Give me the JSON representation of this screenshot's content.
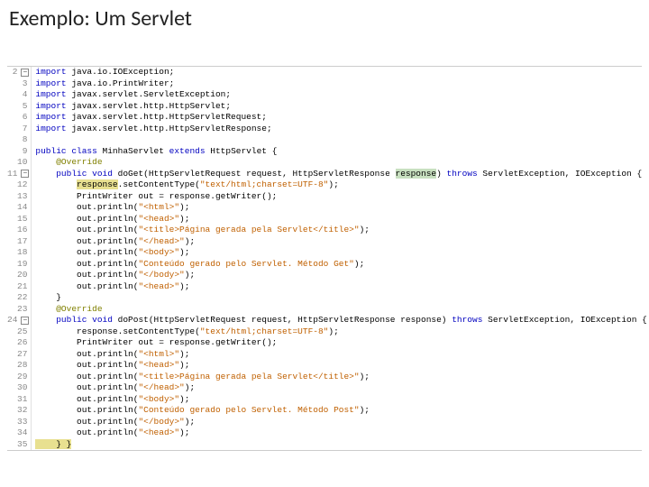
{
  "title": "Exemplo: Um Servlet",
  "code": {
    "line_numbers": [
      "2",
      "3",
      "4",
      "5",
      "6",
      "7",
      "8",
      "9",
      "10",
      "11",
      "12",
      "13",
      "14",
      "15",
      "16",
      "17",
      "18",
      "19",
      "20",
      "21",
      "22",
      "23",
      "24",
      "25",
      "26",
      "27",
      "28",
      "29",
      "30",
      "31",
      "32",
      "33",
      "34",
      "35"
    ],
    "fold_lines": [
      0,
      9,
      22
    ],
    "lines": [
      [
        {
          "t": "kw",
          "s": "import"
        },
        {
          "t": "",
          "s": " java.io.IOException;"
        }
      ],
      [
        {
          "t": "kw",
          "s": "import"
        },
        {
          "t": "",
          "s": " java.io.PrintWriter;"
        }
      ],
      [
        {
          "t": "kw",
          "s": "import"
        },
        {
          "t": "",
          "s": " javax.servlet.ServletException;"
        }
      ],
      [
        {
          "t": "kw",
          "s": "import"
        },
        {
          "t": "",
          "s": " javax.servlet.http.HttpServlet;"
        }
      ],
      [
        {
          "t": "kw",
          "s": "import"
        },
        {
          "t": "",
          "s": " javax.servlet.http.HttpServletRequest;"
        }
      ],
      [
        {
          "t": "kw",
          "s": "import"
        },
        {
          "t": "",
          "s": " javax.servlet.http.HttpServletResponse;"
        }
      ],
      [
        {
          "t": "",
          "s": ""
        }
      ],
      [
        {
          "t": "kw",
          "s": "public class"
        },
        {
          "t": "",
          "s": " MinhaServlet "
        },
        {
          "t": "kw",
          "s": "extends"
        },
        {
          "t": "",
          "s": " HttpServlet {"
        }
      ],
      [
        {
          "t": "",
          "s": "    "
        },
        {
          "t": "ann",
          "s": "@Override"
        }
      ],
      [
        {
          "t": "",
          "s": "    "
        },
        {
          "t": "kw",
          "s": "public void"
        },
        {
          "t": "",
          "s": " doGet(HttpServletRequest request, HttpServletResponse "
        },
        {
          "t": "hl-g",
          "s": "response"
        },
        {
          "t": "",
          "s": ") "
        },
        {
          "t": "kw",
          "s": "throws"
        },
        {
          "t": "",
          "s": " ServletException, IOException {"
        }
      ],
      [
        {
          "t": "",
          "s": "        "
        },
        {
          "t": "hl-y",
          "s": "response"
        },
        {
          "t": "",
          "s": ".setContentType("
        },
        {
          "t": "str",
          "s": "\"text/html;charset=UTF-8\""
        },
        {
          "t": "",
          "s": ");"
        }
      ],
      [
        {
          "t": "",
          "s": "        PrintWriter out = response.getWriter();"
        }
      ],
      [
        {
          "t": "",
          "s": "        out.println("
        },
        {
          "t": "str",
          "s": "\"<html>\""
        },
        {
          "t": "",
          "s": ");"
        }
      ],
      [
        {
          "t": "",
          "s": "        out.println("
        },
        {
          "t": "str",
          "s": "\"<head>\""
        },
        {
          "t": "",
          "s": ");"
        }
      ],
      [
        {
          "t": "",
          "s": "        out.println("
        },
        {
          "t": "str",
          "s": "\"<title>Página gerada pela Servlet</title>\""
        },
        {
          "t": "",
          "s": ");"
        }
      ],
      [
        {
          "t": "",
          "s": "        out.println("
        },
        {
          "t": "str",
          "s": "\"</head>\""
        },
        {
          "t": "",
          "s": ");"
        }
      ],
      [
        {
          "t": "",
          "s": "        out.println("
        },
        {
          "t": "str",
          "s": "\"<body>\""
        },
        {
          "t": "",
          "s": ");"
        }
      ],
      [
        {
          "t": "",
          "s": "        out.println("
        },
        {
          "t": "str",
          "s": "\"Conteúdo gerado pelo Servlet. Método Get\""
        },
        {
          "t": "",
          "s": ");"
        }
      ],
      [
        {
          "t": "",
          "s": "        out.println("
        },
        {
          "t": "str",
          "s": "\"</body>\""
        },
        {
          "t": "",
          "s": ");"
        }
      ],
      [
        {
          "t": "",
          "s": "        out.println("
        },
        {
          "t": "str",
          "s": "\"<head>\""
        },
        {
          "t": "",
          "s": ");"
        }
      ],
      [
        {
          "t": "",
          "s": "    }"
        }
      ],
      [
        {
          "t": "",
          "s": "    "
        },
        {
          "t": "ann",
          "s": "@Override"
        }
      ],
      [
        {
          "t": "",
          "s": "    "
        },
        {
          "t": "kw",
          "s": "public void"
        },
        {
          "t": "",
          "s": " doPost(HttpServletRequest request, HttpServletResponse response) "
        },
        {
          "t": "kw",
          "s": "throws"
        },
        {
          "t": "",
          "s": " ServletException, IOException {"
        }
      ],
      [
        {
          "t": "",
          "s": "        response.setContentType("
        },
        {
          "t": "str",
          "s": "\"text/html;charset=UTF-8\""
        },
        {
          "t": "",
          "s": ");"
        }
      ],
      [
        {
          "t": "",
          "s": "        PrintWriter out = response.getWriter();"
        }
      ],
      [
        {
          "t": "",
          "s": "        out.println("
        },
        {
          "t": "str",
          "s": "\"<html>\""
        },
        {
          "t": "",
          "s": ");"
        }
      ],
      [
        {
          "t": "",
          "s": "        out.println("
        },
        {
          "t": "str",
          "s": "\"<head>\""
        },
        {
          "t": "",
          "s": ");"
        }
      ],
      [
        {
          "t": "",
          "s": "        out.println("
        },
        {
          "t": "str",
          "s": "\"<title>Página gerada pela Servlet</title>\""
        },
        {
          "t": "",
          "s": ");"
        }
      ],
      [
        {
          "t": "",
          "s": "        out.println("
        },
        {
          "t": "str",
          "s": "\"</head>\""
        },
        {
          "t": "",
          "s": ");"
        }
      ],
      [
        {
          "t": "",
          "s": "        out.println("
        },
        {
          "t": "str",
          "s": "\"<body>\""
        },
        {
          "t": "",
          "s": ");"
        }
      ],
      [
        {
          "t": "",
          "s": "        out.println("
        },
        {
          "t": "str",
          "s": "\"Conteúdo gerado pelo Servlet. Método Post\""
        },
        {
          "t": "",
          "s": ");"
        }
      ],
      [
        {
          "t": "",
          "s": "        out.println("
        },
        {
          "t": "str",
          "s": "\"</body>\""
        },
        {
          "t": "",
          "s": ");"
        }
      ],
      [
        {
          "t": "",
          "s": "        out.println("
        },
        {
          "t": "str",
          "s": "\"<head>\""
        },
        {
          "t": "",
          "s": ");"
        }
      ],
      [
        {
          "t": "hl-y",
          "s": "    } }"
        }
      ]
    ]
  },
  "fold_symbol": "−"
}
